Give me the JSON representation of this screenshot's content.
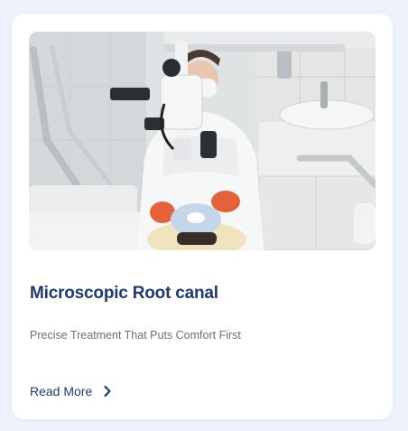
{
  "card": {
    "image_alt": "Dentist performing root canal treatment with a dental microscope",
    "title": "Microscopic Root canal",
    "subtitle": "Precise Treatment That Puts Comfort First",
    "read_more_label": "Read More",
    "read_more_icon": "chevron-right-icon"
  },
  "colors": {
    "page_bg": "#eef2fb",
    "card_bg": "#ffffff",
    "title": "#1f3a6b",
    "subtitle": "#6b6f78",
    "link": "#1f3a6b"
  }
}
